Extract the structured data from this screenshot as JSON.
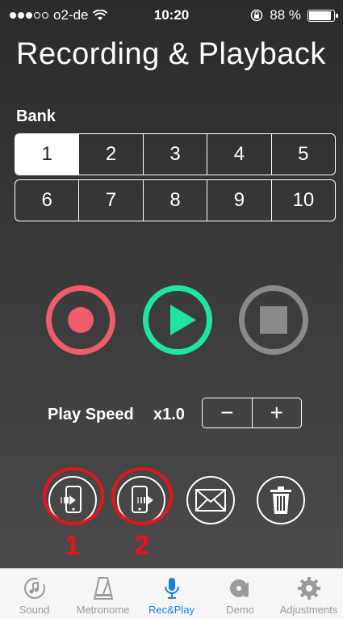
{
  "status_bar": {
    "carrier": "o2-de",
    "time": "10:20",
    "battery": "88 %"
  },
  "page": {
    "title": "Recording & Playback"
  },
  "bank": {
    "label": "Bank",
    "selected": "1",
    "row1": [
      "1",
      "2",
      "3",
      "4",
      "5"
    ],
    "row2": [
      "6",
      "7",
      "8",
      "9",
      "10"
    ]
  },
  "controls": {
    "record_icon": "record-icon",
    "play_icon": "play-icon",
    "stop_icon": "stop-icon"
  },
  "speed": {
    "label": "Play Speed",
    "value": "x1.0",
    "minus": "−",
    "plus": "+"
  },
  "annotations": {
    "one": "1",
    "two": "2"
  },
  "tabs": [
    {
      "label": "Sound",
      "icon": "sound-icon"
    },
    {
      "label": "Metronome",
      "icon": "metronome-icon"
    },
    {
      "label": "Rec&Play",
      "icon": "microphone-icon",
      "active": true
    },
    {
      "label": "Demo",
      "icon": "demo-disc-icon"
    },
    {
      "label": "Adjustments",
      "icon": "gear-icon"
    }
  ],
  "colors": {
    "record": "#f05c6c",
    "play": "#1ee6a0",
    "stop": "#8a8a8a",
    "annotation": "#e8141c",
    "tab_active": "#1e7ee6"
  }
}
